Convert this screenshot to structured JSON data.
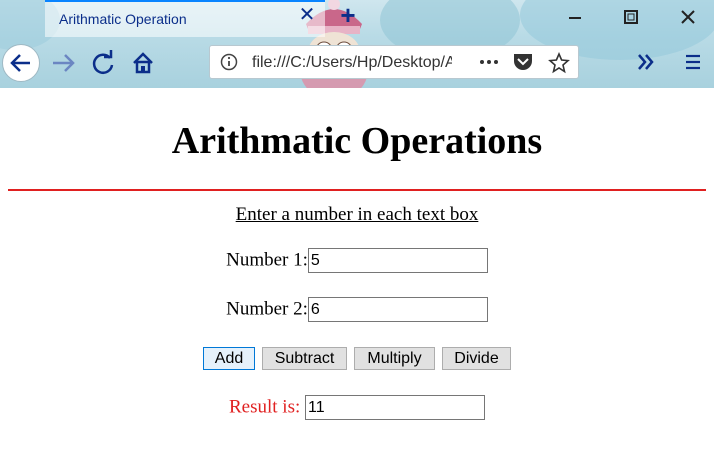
{
  "browser": {
    "tab_title": "Arithmatic Operation",
    "url": "file:///C:/Users/Hp/Desktop/Arithmatic.html",
    "icons": {
      "close_tab": "close-icon",
      "new_tab": "plus-icon",
      "back": "arrow-left-icon",
      "forward": "arrow-right-icon",
      "reload": "reload-icon",
      "home": "home-icon",
      "info": "info-icon",
      "more": "ellipsis-icon",
      "pocket": "pocket-icon",
      "bookmark": "star-icon",
      "overflow": "chevrons-right-icon",
      "menu": "hamburger-icon"
    },
    "accent": "#0b2e8a"
  },
  "page": {
    "title": "Arithmatic Operations",
    "instruction": "Enter a number in each text box",
    "number1_label": "Number 1:",
    "number1_value": "5",
    "number2_label": "Number 2:",
    "number2_value": "6",
    "buttons": {
      "add": "Add",
      "subtract": "Subtract",
      "multiply": "Multiply",
      "divide": "Divide"
    },
    "result_label": "Result is:",
    "result_value": "11",
    "rule_color": "#e02020"
  }
}
